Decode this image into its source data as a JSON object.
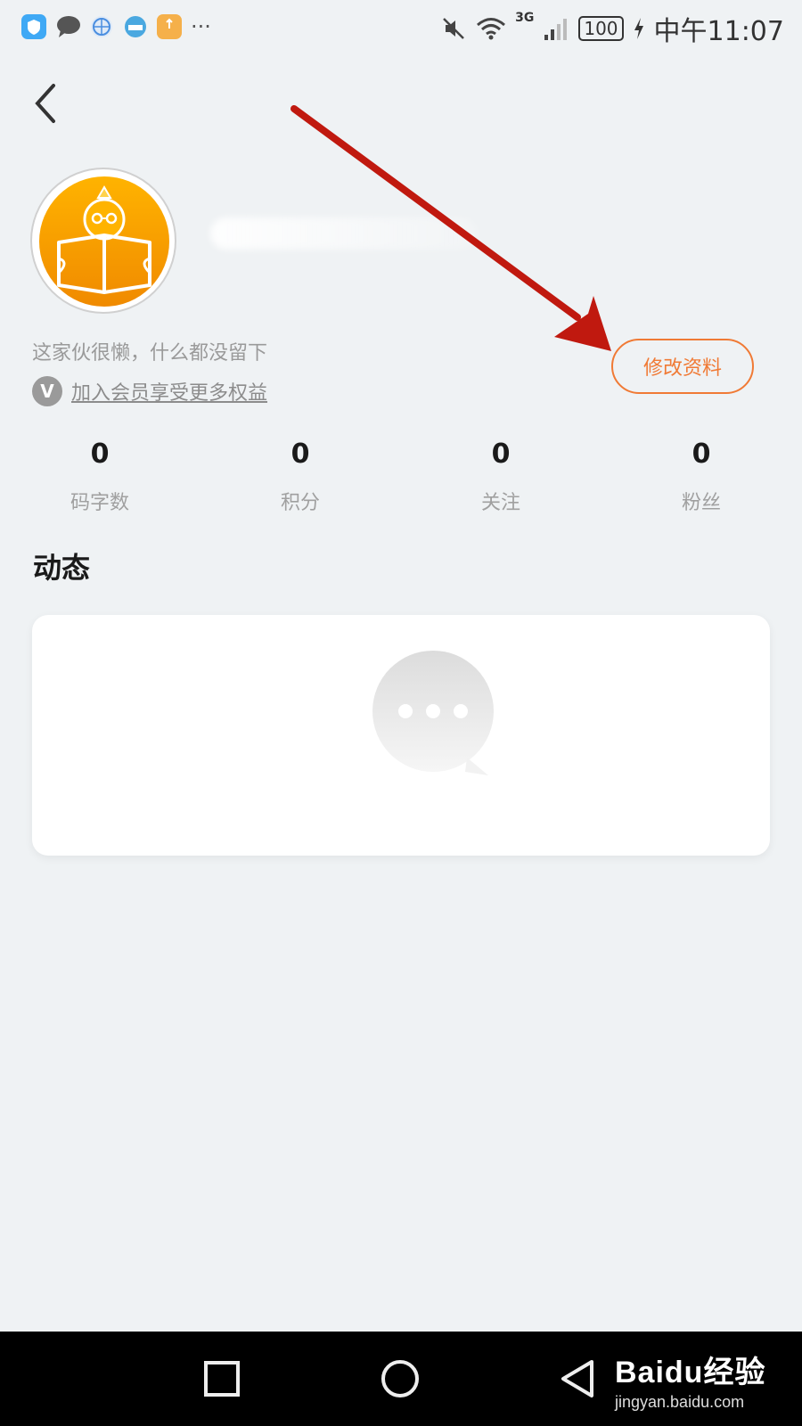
{
  "status_bar": {
    "time": "中午11:07",
    "battery": "100",
    "network": "3G",
    "icons": [
      "shield-app-icon",
      "chat-app-icon",
      "browser-app-icon",
      "map-app-icon",
      "package-app-icon",
      "more-dots-icon",
      "mute-icon",
      "wifi-icon",
      "signal-icon",
      "battery-icon",
      "charging-icon"
    ]
  },
  "profile": {
    "bio": "这家伙很懒，什么都没留下",
    "vip_badge": "V",
    "vip_link": "加入会员享受更多权益",
    "edit_button": "修改资料"
  },
  "stats": [
    {
      "value": "0",
      "label": "码字数"
    },
    {
      "value": "0",
      "label": "积分"
    },
    {
      "value": "0",
      "label": "关注"
    },
    {
      "value": "0",
      "label": "粉丝"
    }
  ],
  "feed": {
    "title": "动态"
  },
  "watermark": {
    "main": "Baidu经验",
    "sub": "jingyan.baidu.com"
  },
  "colors": {
    "accent": "#f07a35",
    "background": "#eff2f4",
    "annotation_arrow": "#c0190f"
  }
}
